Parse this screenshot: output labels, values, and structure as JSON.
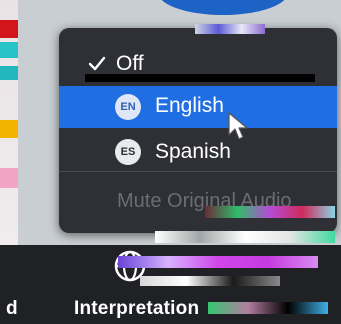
{
  "menu": {
    "items": [
      {
        "label": "Off",
        "checked": true
      },
      {
        "label": "English",
        "badge": "EN",
        "highlighted": true
      },
      {
        "label": "Spanish",
        "badge": "ES"
      }
    ],
    "mute_label": "Mute Original Audio"
  },
  "toolbar": {
    "left_label": "d",
    "label": "Interpretation"
  },
  "colors": {
    "menu_bg": "#2f3035",
    "highlight": "#1f6fe3",
    "toolbar_bg": "#202124"
  },
  "icons": {
    "check": "check-icon",
    "globe": "globe-icon",
    "cursor": "mouse-cursor-icon"
  }
}
